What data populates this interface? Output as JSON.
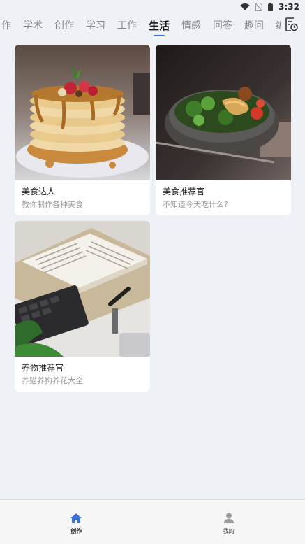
{
  "status_bar": {
    "time": "3:32",
    "icons": [
      "wifi-icon",
      "no-sim-icon",
      "battery-icon"
    ]
  },
  "tabs": {
    "items": [
      {
        "label": "作",
        "partial": true
      },
      {
        "label": "学术"
      },
      {
        "label": "创作"
      },
      {
        "label": "学习"
      },
      {
        "label": "工作"
      },
      {
        "label": "生活",
        "active": true
      },
      {
        "label": "情感"
      },
      {
        "label": "问答"
      },
      {
        "label": "趣问"
      },
      {
        "label": "编程"
      }
    ],
    "history_icon": "history-icon"
  },
  "cards": [
    {
      "title": "美食达人",
      "desc": "教你制作各种美食",
      "image": "pancakes"
    },
    {
      "title": "美食推荐官",
      "desc": "不知道今天吃什么?",
      "image": "salad-bowl"
    },
    {
      "title": "养物推荐官",
      "desc": "养猫养狗养花大全",
      "image": "desk-book"
    }
  ],
  "bottom_nav": {
    "items": [
      {
        "label": "创作",
        "icon": "home-icon",
        "active": true
      },
      {
        "label": "我的",
        "icon": "user-icon"
      }
    ]
  },
  "colors": {
    "accent": "#3b6fe0",
    "background": "#eef1f5",
    "card": "#ffffff"
  }
}
